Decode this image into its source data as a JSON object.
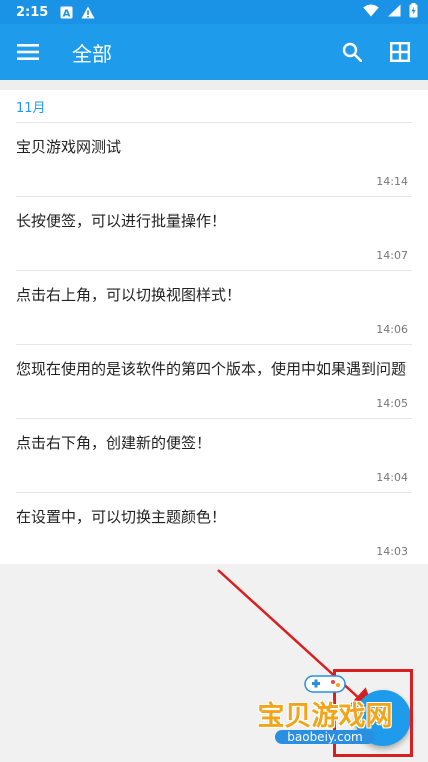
{
  "status": {
    "time": "2:15",
    "icons": [
      "a-notification-icon",
      "alert-icon",
      "wifi-icon",
      "signal-icon",
      "battery-icon"
    ]
  },
  "app_bar": {
    "title": "全部",
    "menu_icon": "menu-icon",
    "search_icon": "search-icon",
    "grid_icon": "grid-view-icon"
  },
  "list": {
    "month": "11月",
    "notes": [
      {
        "title": "宝贝游戏网测试",
        "time": "14:14"
      },
      {
        "title": "长按便签，可以进行批量操作！",
        "time": "14:07"
      },
      {
        "title": "点击右上角，可以切换视图样式！",
        "time": "14:06"
      },
      {
        "title": "您现在使用的是该软件的第四个版本，使用中如果遇到问题",
        "time": "14:05"
      },
      {
        "title": "点击右下角，创建新的便签！",
        "time": "14:04"
      },
      {
        "title": "在设置中，可以切换主题颜色！",
        "time": "14:03"
      }
    ]
  },
  "fab": {
    "icon": "plus-icon"
  },
  "watermark": {
    "text": "宝贝游戏网",
    "url": "baobeiy.com"
  },
  "colors": {
    "primary": "#1e9ceb",
    "status_bar": "#1a93e6",
    "annotation": "#d82020"
  }
}
